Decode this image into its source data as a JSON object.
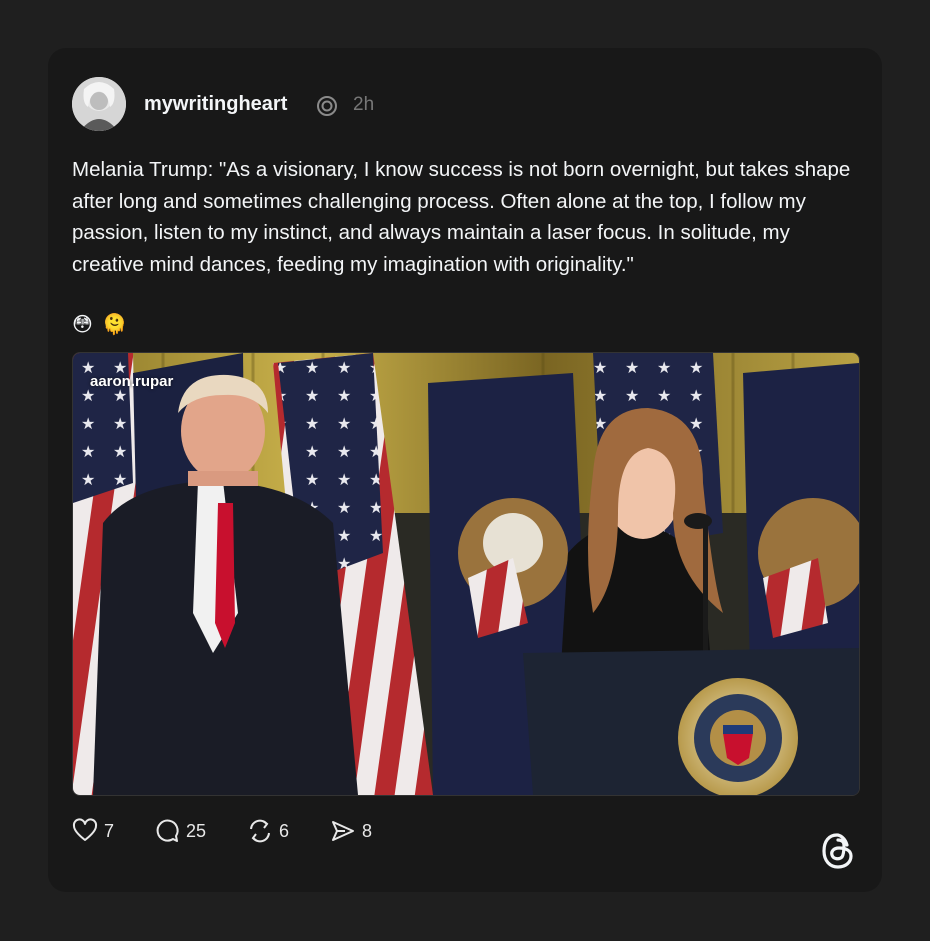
{
  "post": {
    "username": "mywritingheart",
    "time": "2h",
    "text": "Melania Trump: \"As a visionary, I know success is not born overnight, but takes shape after long and sometimes challenging process. Often alone at the top, I follow my passion, listen to my instinct, and always maintain a laser focus. In solitude, my creative mind dances, feeding my imagination with originality.\"",
    "emojis": "😳 🫠",
    "media_watermark": "aaron.rupar",
    "seal_text": "SEAL OF THE PRESIDENT OF THE UNITED STATES"
  },
  "actions": {
    "likes": "7",
    "replies": "25",
    "reposts": "6",
    "shares": "8"
  },
  "icons": {
    "verified": "threads-badge-icon",
    "like": "heart-icon",
    "reply": "speech-bubble-icon",
    "repost": "repost-icon",
    "share": "send-icon",
    "brand": "threads-logo-icon"
  },
  "colors": {
    "page_bg": "#1f1f1f",
    "card_bg": "#181818",
    "text": "#f3f5f7",
    "muted": "#777777"
  }
}
